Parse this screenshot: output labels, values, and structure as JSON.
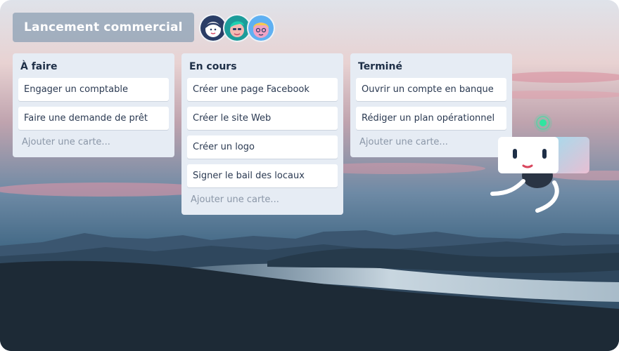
{
  "board": {
    "title": "Lancement commercial",
    "members": [
      "member-avatar-1",
      "member-avatar-2",
      "member-avatar-3"
    ]
  },
  "lists": [
    {
      "title": "À faire",
      "cards": [
        "Engager un comptable",
        "Faire une demande de prêt"
      ],
      "add_card": "Ajouter une carte..."
    },
    {
      "title": "En cours",
      "cards": [
        "Créer une page Facebook",
        "Créer le site Web",
        "Créer un logo",
        "Signer le bail des locaux"
      ],
      "add_card": "Ajouter une carte..."
    },
    {
      "title": "Terminé",
      "cards": [
        "Ouvrir un compte en banque",
        "Rédiger un plan opérationnel"
      ],
      "add_card": "Ajouter une carte..."
    }
  ],
  "colors": {
    "list_bg": "#e6ecf4",
    "card_bg": "#ffffff",
    "title_text": "#1e2f47",
    "placeholder_text": "#8b97a8",
    "robot_signal": "#2ee6a0"
  },
  "icons": [
    "mountain-sunset-background",
    "robot-mascot-icon",
    "signal-dot-icon"
  ]
}
